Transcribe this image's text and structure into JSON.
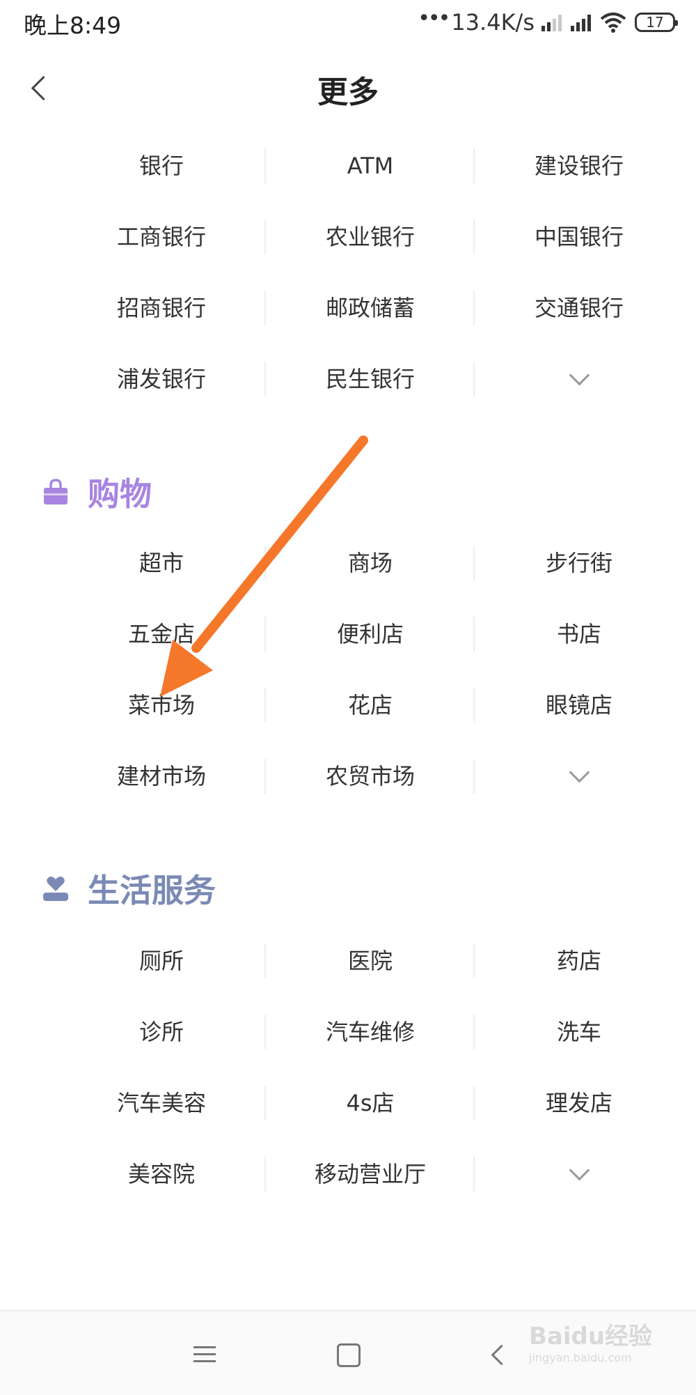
{
  "status_bar": {
    "time": "晚上8:49",
    "net_dots": "•••",
    "net_speed": "13.4K/s",
    "battery": "17"
  },
  "header": {
    "title": "更多",
    "back_icon": "chevron-left-icon"
  },
  "bank_section": {
    "rows": [
      [
        "银行",
        "ATM",
        "建设银行"
      ],
      [
        "工商银行",
        "农业银行",
        "中国银行"
      ],
      [
        "招商银行",
        "邮政储蓄",
        "交通银行"
      ],
      [
        "浦发银行",
        "民生银行",
        ""
      ]
    ]
  },
  "shopping_section": {
    "title": "购物",
    "icon": "shopping-bag-icon",
    "color": "#a785e0",
    "rows": [
      [
        "超市",
        "商场",
        "步行街"
      ],
      [
        "五金店",
        "便利店",
        "书店"
      ],
      [
        "菜市场",
        "花店",
        "眼镜店"
      ],
      [
        "建材市场",
        "农贸市场",
        ""
      ]
    ]
  },
  "life_section": {
    "title": "生活服务",
    "icon": "heart-person-icon",
    "color": "#7b8ab5",
    "rows": [
      [
        "厕所",
        "医院",
        "药店"
      ],
      [
        "诊所",
        "汽车维修",
        "洗车"
      ],
      [
        "汽车美容",
        "4s店",
        "理发店"
      ],
      [
        "美容院",
        "移动营业厅",
        ""
      ]
    ]
  },
  "annotation": {
    "color": "#f5772a"
  },
  "nav_bar": {
    "icons": [
      "menu-icon",
      "home-icon",
      "back-icon"
    ]
  },
  "watermark": {
    "top": "Baidu经验",
    "bottom": "jingyan.baidu.com"
  }
}
